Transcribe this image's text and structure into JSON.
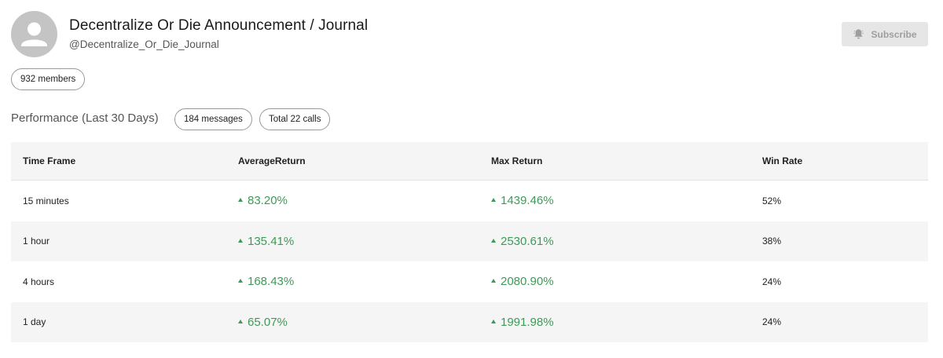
{
  "channel": {
    "title": "Decentralize Or Die Announcement / Journal",
    "handle": "@Decentralize_Or_Die_Journal",
    "members": "932 members",
    "subscribe_label": "Subscribe"
  },
  "performance": {
    "title": "Performance (Last 30 Days)",
    "messages": "184 messages",
    "calls": "Total 22 calls"
  },
  "table": {
    "headers": [
      "Time Frame",
      "AverageReturn",
      "Max Return",
      "Win Rate"
    ],
    "rows": [
      {
        "timeframe": "15 minutes",
        "avg": "83.20%",
        "max": "1439.46%",
        "win": "52%"
      },
      {
        "timeframe": "1 hour",
        "avg": "135.41%",
        "max": "2530.61%",
        "win": "38%"
      },
      {
        "timeframe": "4 hours",
        "avg": "168.43%",
        "max": "2080.90%",
        "win": "24%"
      },
      {
        "timeframe": "1 day",
        "avg": "65.07%",
        "max": "1991.98%",
        "win": "24%"
      }
    ]
  },
  "icons": {
    "avatar": "user-silhouette-icon",
    "subscribe": "bell-icon",
    "trend": "arrow-up-icon"
  },
  "colors": {
    "positive": "#3d9a57",
    "subscribe_bg": "#e6e6e6",
    "row_alt": "#f5f5f5"
  }
}
